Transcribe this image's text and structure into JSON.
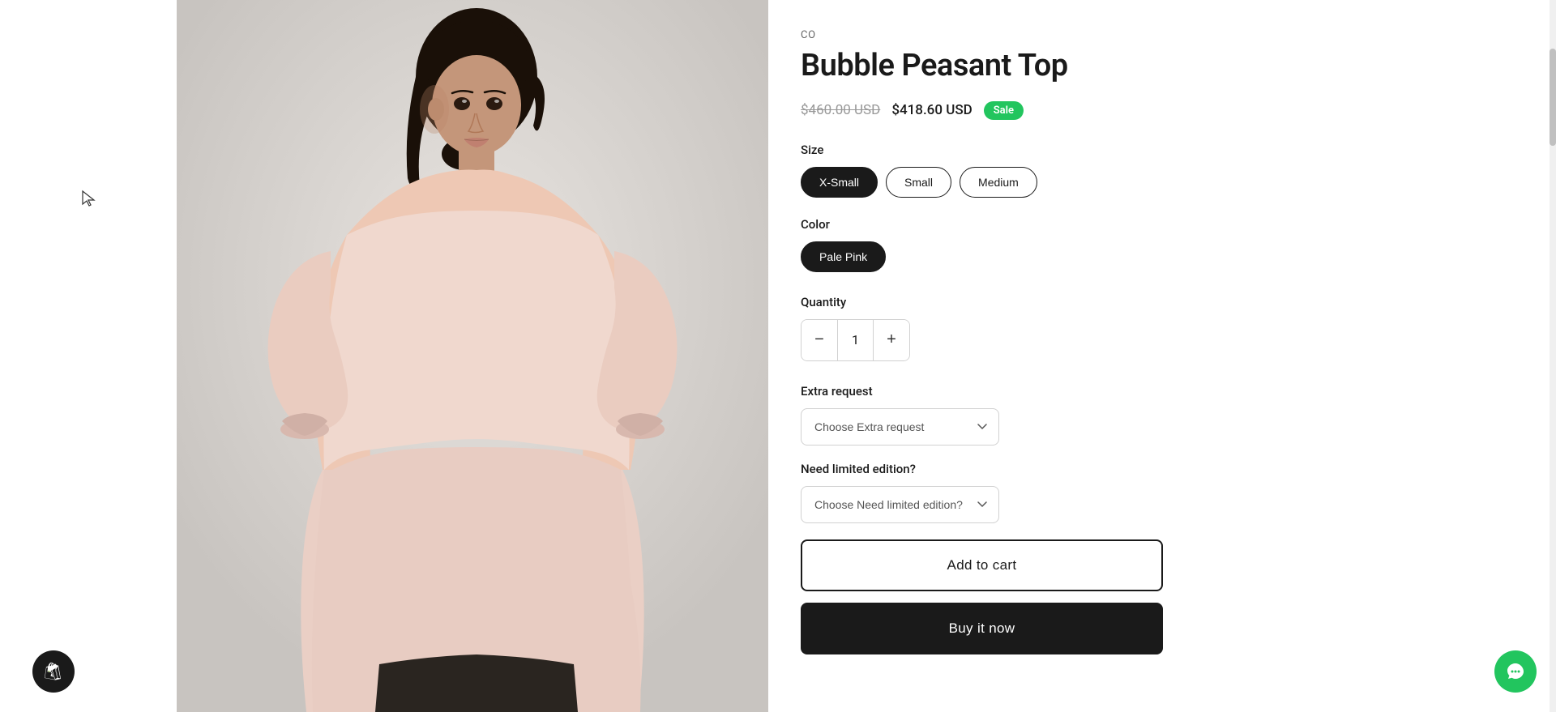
{
  "brand": "CO",
  "product": {
    "title": "Bubble Peasant Top",
    "original_price": "$460.00 USD",
    "sale_price": "$418.60 USD",
    "sale_badge": "Sale"
  },
  "size_section": {
    "label": "Size",
    "options": [
      "X-Small",
      "Small",
      "Medium"
    ],
    "selected": "X-Small"
  },
  "color_section": {
    "label": "Color",
    "options": [
      "Pale Pink"
    ],
    "selected": "Pale Pink"
  },
  "quantity_section": {
    "label": "Quantity",
    "value": 1,
    "decrease_label": "−",
    "increase_label": "+"
  },
  "extra_request": {
    "label": "Extra request",
    "placeholder": "Choose Extra request",
    "options": [
      "Choose Extra request"
    ]
  },
  "limited_edition": {
    "label": "Need limited edition?",
    "placeholder": "Choose Need limited edition?",
    "options": [
      "Choose Need limited edition?"
    ]
  },
  "add_to_cart_label": "Add to cart",
  "buy_now_label": "Buy it now",
  "shopify_icon": "🛍",
  "chat_icon": "💬"
}
